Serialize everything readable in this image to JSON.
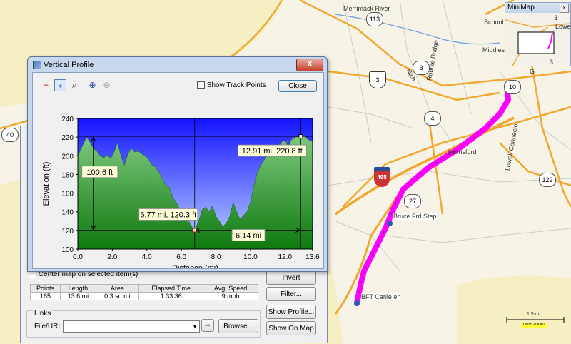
{
  "map": {
    "labels": {
      "merrimack_river": "Merrimack River",
      "school": "School",
      "middlesex": "Middlesex",
      "rourke_bridge": "Rourke Bridge",
      "nichols": "Nich",
      "chelmsford": "helmsford",
      "lowell_connector": "Lowell Connector",
      "bruce_frd_step": "Bruce Frd Step",
      "bft_carlie": "BFT Carlie en",
      "g": "G"
    },
    "shields": {
      "r113": "113",
      "r3a": "3",
      "r3b": "3",
      "r4": "4",
      "r40": "40",
      "r27": "27",
      "r129": "129",
      "r110": "10",
      "i495": "495"
    },
    "scale": {
      "distance": "1.5 mi",
      "mode": "overzoom"
    },
    "colors": {
      "track": "#ff00ff",
      "highway": "#f0a830",
      "road": "#cccccc",
      "water": "#6aa0e0"
    }
  },
  "minimap": {
    "title": "MiniMap",
    "close_glyph": "x",
    "labels": {
      "three": "3",
      "lowell": "Lowell",
      "three_b": "3"
    }
  },
  "main_dialog": {
    "center_map_label": "Center map on selected item(s)",
    "buttons": {
      "invert": "Invert",
      "filter": "Filter...",
      "show_profile": "Show Profile...",
      "show_on_map": "Show On Map",
      "browse": "Browse..."
    },
    "stats": {
      "headers": [
        "Points",
        "Length",
        "Area",
        "Elapsed Time",
        "Avg. Speed"
      ],
      "values": [
        "165",
        "13.6 mi",
        "0.3 sq mi",
        "1:33:36",
        "9 mph"
      ]
    },
    "links": {
      "group_label": "Links",
      "file_url_label": "File/URL:",
      "file_url_value": ""
    }
  },
  "vertical_profile": {
    "title": "Vertical Profile",
    "close_glyph": "X",
    "show_track_points_label": "Show Track Points",
    "show_track_points_checked": false,
    "close_button": "Close",
    "tools": [
      "crosshair-red",
      "crosshair-blue",
      "zoom-rect",
      "zoom-in",
      "zoom-out"
    ],
    "tool_icons": [
      "⌖",
      "⌖",
      "⌕",
      "⊕",
      "⊖"
    ]
  },
  "chart_data": {
    "type": "area",
    "xlabel": "Distance  (mi)",
    "ylabel": "Elevation (ft)",
    "xlim": [
      0,
      13.6
    ],
    "ylim": [
      100,
      240
    ],
    "xticks": [
      "0.0",
      "2.0",
      "4.0",
      "6.0",
      "8.0",
      "10.0",
      "12.0",
      "13.6"
    ],
    "xtick_values": [
      0,
      2,
      4,
      6,
      8,
      10,
      12,
      13.6
    ],
    "yticks": [
      "100",
      "120",
      "140",
      "160",
      "180",
      "200",
      "220",
      "240"
    ],
    "ytick_values": [
      100,
      120,
      140,
      160,
      180,
      200,
      220,
      240
    ],
    "grid": false,
    "x": [
      0,
      0.3,
      0.5,
      0.7,
      0.9,
      1.1,
      1.3,
      1.5,
      1.7,
      1.9,
      2.1,
      2.3,
      2.5,
      2.7,
      2.9,
      3.1,
      3.3,
      3.5,
      3.7,
      3.9,
      4.1,
      4.3,
      4.5,
      4.7,
      4.9,
      5.1,
      5.3,
      5.5,
      5.7,
      5.9,
      6.1,
      6.3,
      6.5,
      6.77,
      7.0,
      7.2,
      7.4,
      7.6,
      7.8,
      8.0,
      8.2,
      8.4,
      8.6,
      8.8,
      9.0,
      9.2,
      9.4,
      9.6,
      9.8,
      10.0,
      10.2,
      10.4,
      10.6,
      10.8,
      11.0,
      11.2,
      11.4,
      11.6,
      11.8,
      12.0,
      12.2,
      12.4,
      12.6,
      12.91,
      13.1,
      13.3,
      13.6
    ],
    "y": [
      200,
      212,
      220,
      215,
      208,
      205,
      200,
      198,
      201,
      197,
      204,
      214,
      200,
      190,
      202,
      208,
      204,
      205,
      202,
      200,
      196,
      190,
      188,
      182,
      176,
      168,
      166,
      155,
      150,
      143,
      140,
      134,
      128,
      120.3,
      130,
      142,
      145,
      140,
      146,
      135,
      130,
      124,
      128,
      135,
      150,
      140,
      132,
      136,
      140,
      150,
      168,
      182,
      190,
      196,
      204,
      210,
      212,
      206,
      215,
      216,
      210,
      218,
      220,
      220.8,
      222,
      218,
      215
    ],
    "annotations": [
      {
        "label": "12.91 mi, 220.8 ft",
        "x": 12.91,
        "y": 220.8
      },
      {
        "label": "6.77 mi, 120.3 ft",
        "x": 6.77,
        "y": 120.3
      },
      {
        "label": "100.6 ft",
        "type": "vertical-span",
        "x": 0.9,
        "y_from": 120.3,
        "y_to": 220.8
      },
      {
        "label": "6.14 mi",
        "type": "horizontal-span",
        "y": 120.3,
        "x_from": 6.77,
        "x_to": 12.91
      }
    ],
    "colors": {
      "sky_top": "#1414ff",
      "sky_bottom": "#bcd6ff",
      "terrain_top": "#7fc87f",
      "terrain_bottom": "#0e7a0e"
    }
  }
}
